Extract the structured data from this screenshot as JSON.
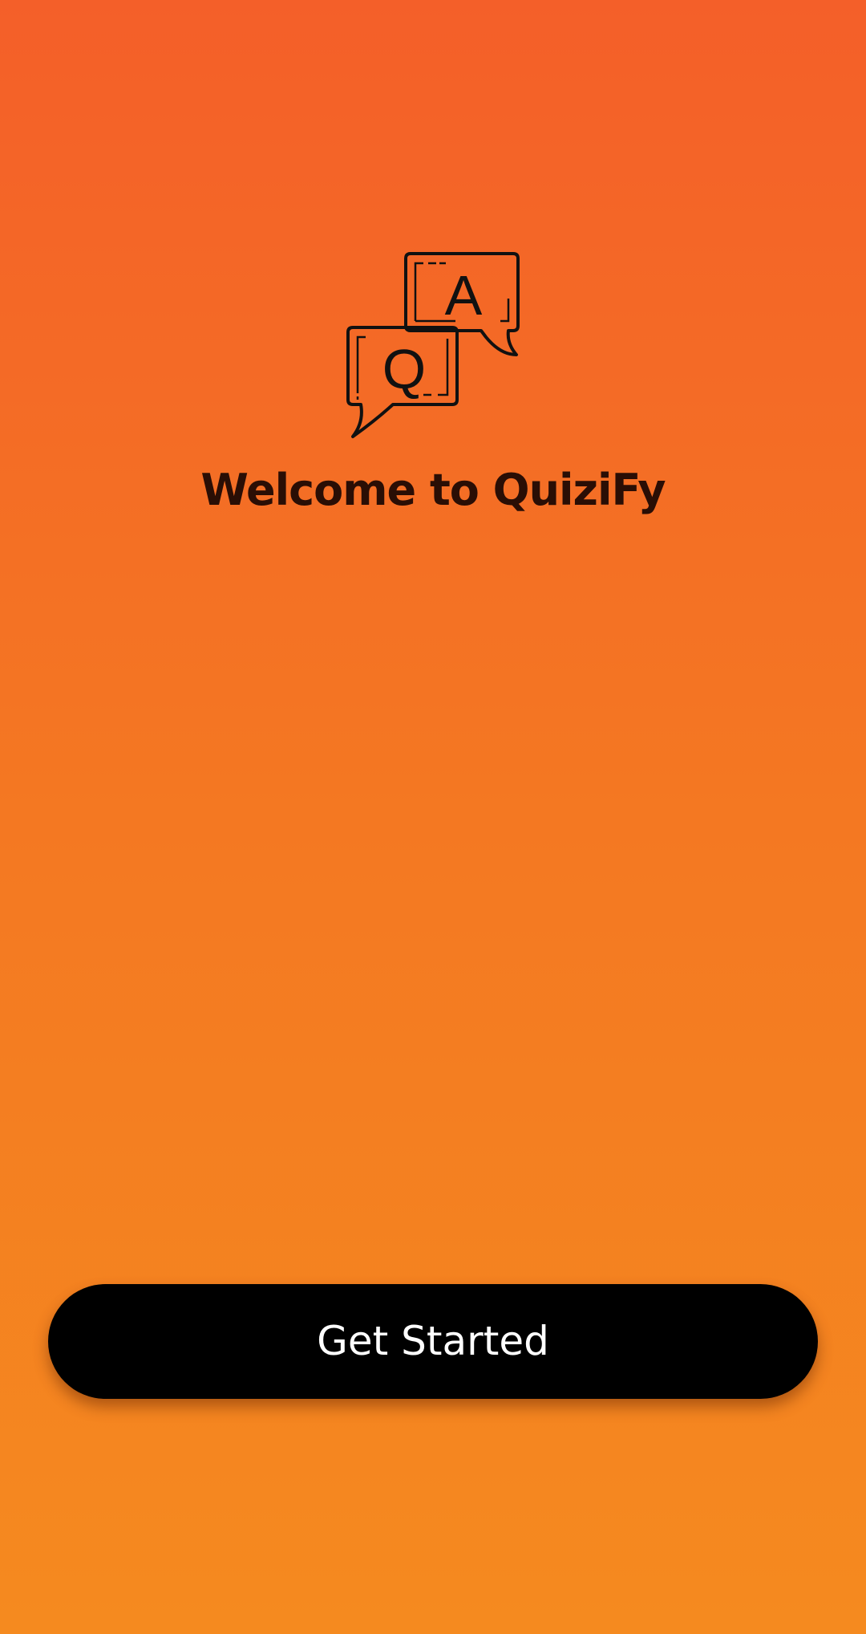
{
  "app": {
    "background_colors": [
      "#f45f29",
      "#f58a1f"
    ]
  },
  "logo": {
    "icon": "qa-speech-bubbles-icon",
    "question_letter": "Q",
    "answer_letter": "A"
  },
  "welcome": {
    "title": "Welcome to QuiziFy"
  },
  "actions": {
    "get_started_label": "Get Started",
    "button_color": "#000000",
    "button_text_color": "#ffffff"
  }
}
